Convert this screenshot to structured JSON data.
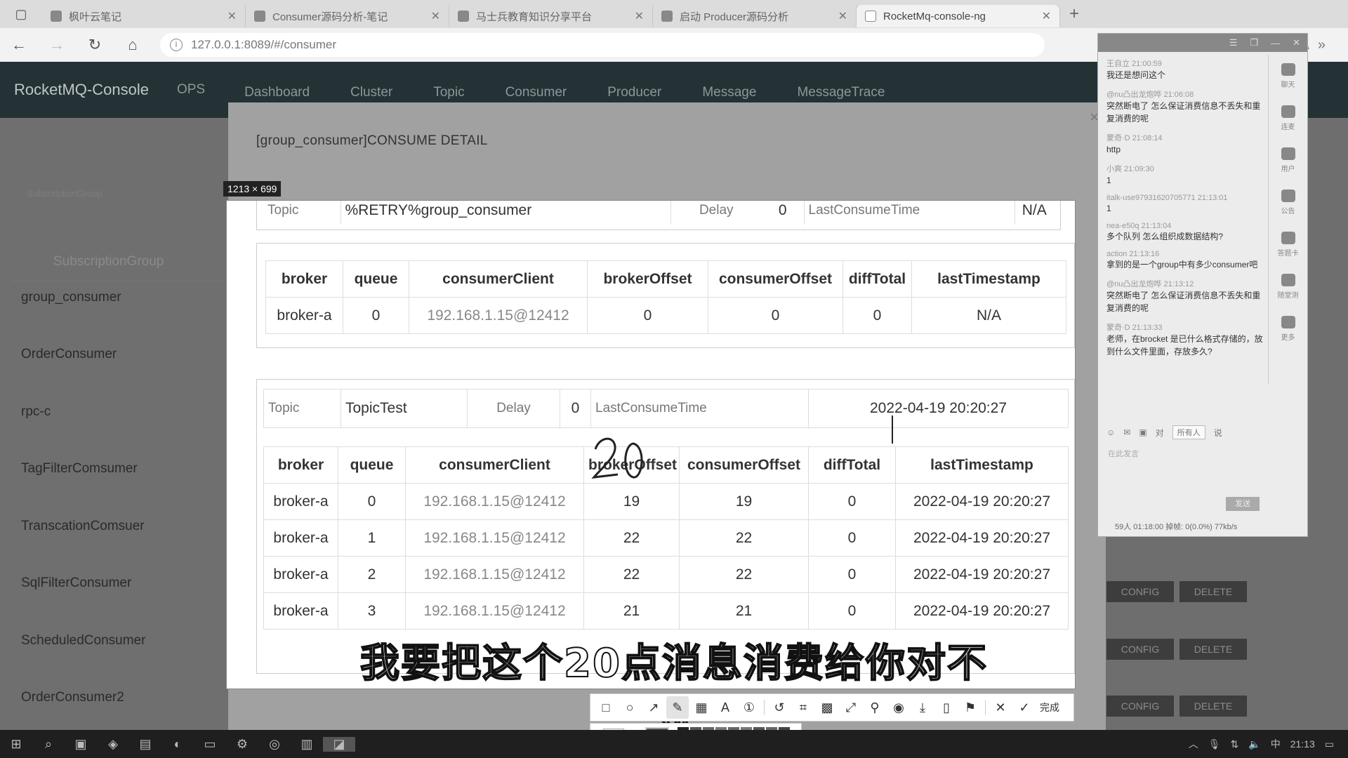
{
  "browser": {
    "tabs": [
      {
        "label": "枫叶云笔记",
        "active": false
      },
      {
        "label": "Consumer源码分析-笔记",
        "active": false
      },
      {
        "label": "马士兵教育知识分享平台",
        "active": false
      },
      {
        "label": "启动 Producer源码分析",
        "active": false
      },
      {
        "label": "RocketMq-console-ng",
        "active": true
      }
    ],
    "url": "127.0.0.1:8089/#/consumer"
  },
  "app": {
    "brand": "RocketMQ-Console",
    "nav": [
      "OPS",
      "Dashboard",
      "Cluster",
      "Topic",
      "Consumer",
      "Producer",
      "Message",
      "MessageTrace"
    ]
  },
  "left_panel": {
    "sub_small": "SubscriptionGroup",
    "header": "SubscriptionGroup",
    "groups": [
      "group_consumer",
      "OrderConsumer",
      "rpc-c",
      "TagFilterComsumer",
      "TranscationComsuer",
      "SqlFilterConsumer",
      "ScheduledConsumer",
      "OrderConsumer2"
    ]
  },
  "modal": {
    "title": "[group_consumer]CONSUME DETAIL",
    "close": "×"
  },
  "capture_size_label": "1213 × 699",
  "detail": {
    "blocks": [
      {
        "topic_label": "Topic",
        "topic": "%RETRY%group_consumer",
        "delay_label": "Delay",
        "delay": "0",
        "last_consume_label": "LastConsumeTime",
        "last_consume_time": "N/A",
        "columns": [
          "broker",
          "queue",
          "consumerClient",
          "brokerOffset",
          "consumerOffset",
          "diffTotal",
          "lastTimestamp"
        ],
        "rows": [
          [
            "broker-a",
            "0",
            "192.168.1.15@12412",
            "0",
            "0",
            "0",
            "N/A"
          ]
        ]
      },
      {
        "topic_label": "Topic",
        "topic": "TopicTest",
        "delay_label": "Delay",
        "delay": "0",
        "last_consume_label": "LastConsumeTime",
        "last_consume_time": "2022-04-19 20:20:27",
        "columns": [
          "broker",
          "queue",
          "consumerClient",
          "brokerOffset",
          "consumerOffset",
          "diffTotal",
          "lastTimestamp"
        ],
        "rows": [
          [
            "broker-a",
            "0",
            "192.168.1.15@12412",
            "19",
            "19",
            "0",
            "2022-04-19 20:20:27"
          ],
          [
            "broker-a",
            "1",
            "192.168.1.15@12412",
            "22",
            "22",
            "0",
            "2022-04-19 20:20:27"
          ],
          [
            "broker-a",
            "2",
            "192.168.1.15@12412",
            "22",
            "22",
            "0",
            "2022-04-19 20:20:27"
          ],
          [
            "broker-a",
            "3",
            "192.168.1.15@12412",
            "21",
            "21",
            "0",
            "2022-04-19 20:20:27"
          ]
        ]
      }
    ]
  },
  "annotation": {
    "handwritten": "20"
  },
  "side_actions": {
    "config": "CONFIG",
    "delete": "DELETE"
  },
  "chat": {
    "messages": [
      {
        "who": "王自立 21:00:59",
        "text": "我还是想问这个"
      },
      {
        "who": "@nu凸出龙炮哗 21:06:08",
        "text": "突然断电了 怎么保证消费信息不丢失和重复消费的呢"
      },
      {
        "who": "蒙奇·D 21:08:14",
        "text": "http"
      },
      {
        "who": "小爽 21:09:30",
        "text": "1"
      },
      {
        "who": "italk-use97931620705771 21:13:01",
        "text": "1"
      },
      {
        "who": "nea-e50q 21:13:04",
        "text": "多个队列 怎么组织成数据结构?"
      },
      {
        "who": "action 21:13:16",
        "text": "拿到的是一个group中有多少consumer吧"
      },
      {
        "who": "@nu凸出龙炮哗 21:13:12",
        "text": "突然断电了 怎么保证消费信息不丢失和重复消费的呢"
      },
      {
        "who": "蒙奇·D 21:13:33",
        "text": "老师，在brocket 是已什么格式存储的，放到什么文件里面，存放多久?"
      }
    ],
    "side": [
      "聊天",
      "连麦",
      "用户",
      "公告",
      "答题卡",
      "随堂测",
      "更多"
    ],
    "to_label": "对",
    "to_value": "所有人",
    "say_label": "说",
    "placeholder": "在此发言",
    "send": "发送",
    "status": "59人   01:18:00   掉帧: 0(0.0%) 77kb/s"
  },
  "snip_tools": {
    "icons": [
      "rect-icon",
      "ellipse-icon",
      "arrow-icon",
      "pen-icon",
      "mosaic-icon",
      "text-icon",
      "number-icon",
      "undo-icon",
      "ocr-icon",
      "qr-icon",
      "scroll-capture-icon",
      "pin-icon",
      "record-icon",
      "download-icon",
      "copy-icon",
      "bookmark-icon",
      "close-icon"
    ],
    "done": "完成"
  },
  "subtitle": "我要把这个20点消息消费给你对不对",
  "taskbar": {
    "time": "21:13",
    "ime": "中"
  }
}
